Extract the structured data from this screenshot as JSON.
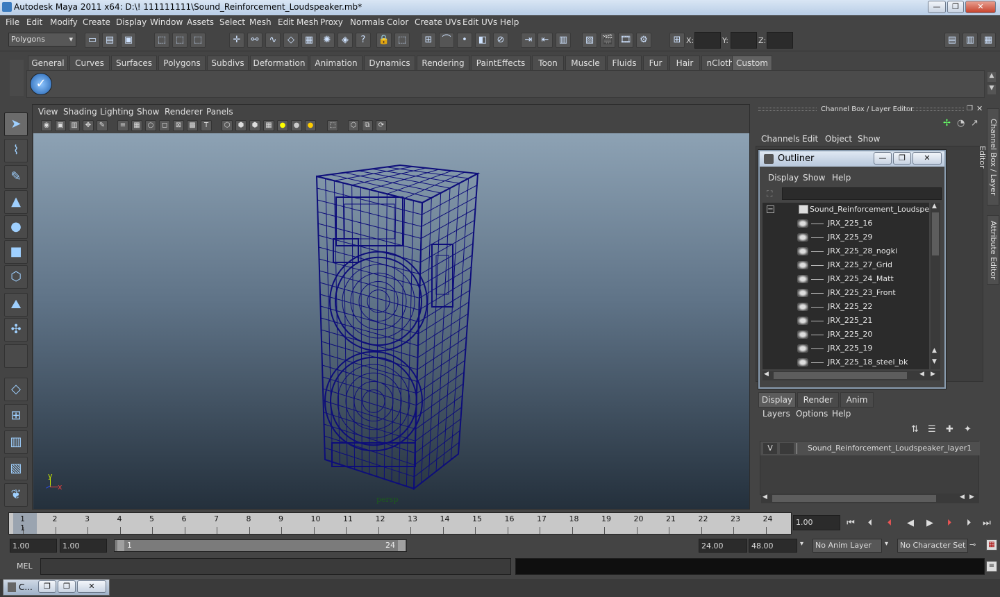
{
  "window": {
    "title": "Autodesk Maya 2011 x64: D:\\! 111111111\\Sound_Reinforcement_Loudspeaker.mb*",
    "minimize": "—",
    "restore": "❐",
    "close": "✕"
  },
  "menubar": [
    "File",
    "Edit",
    "Modify",
    "Create",
    "Display",
    "Window",
    "Assets",
    "Select",
    "Mesh",
    "Edit Mesh",
    "Proxy",
    "Normals",
    "Color",
    "Create UVs",
    "Edit UVs",
    "Help"
  ],
  "statusline": {
    "mode": "Polygons",
    "x_label": "X:",
    "y_label": "Y:",
    "z_label": "Z:"
  },
  "shelf": {
    "tabs": [
      "General",
      "Curves",
      "Surfaces",
      "Polygons",
      "Subdivs",
      "Deformation",
      "Animation",
      "Dynamics",
      "Rendering",
      "PaintEffects",
      "Toon",
      "Muscle",
      "Fluids",
      "Fur",
      "Hair",
      "nCloth",
      "Custom"
    ],
    "active": "Custom"
  },
  "viewport": {
    "menu": [
      "View",
      "Shading",
      "Lighting",
      "Show",
      "Renderer",
      "Panels"
    ],
    "camera": "persp",
    "axis_y": "y",
    "axis_x": "x"
  },
  "channelbox": {
    "title": "Channel Box / Layer Editor",
    "menu": [
      "Channels",
      "Edit",
      "Object",
      "Show"
    ]
  },
  "outliner": {
    "title": "Outliner",
    "menu": [
      "Display",
      "Show",
      "Help"
    ],
    "root": "Sound_Reinforcement_Loudspeaker",
    "items": [
      "JRX_225_16",
      "JRX_225_29",
      "JRX_225_28_nogki",
      "JRX_225_27_Grid",
      "JRX_225_24_Matt",
      "JRX_225_23_Front",
      "JRX_225_22",
      "JRX_225_21",
      "JRX_225_20",
      "JRX_225_19",
      "JRX_225_18_steel_bk"
    ]
  },
  "layers": {
    "tabs": [
      "Display",
      "Render",
      "Anim"
    ],
    "active": "Display",
    "menu": [
      "Layers",
      "Options",
      "Help"
    ],
    "visible_flag": "V",
    "layer_name": "Sound_Reinforcement_Loudspeaker_layer1"
  },
  "sidetabs": [
    "Channel Box / Layer Editor",
    "Attribute Editor"
  ],
  "timeline": {
    "ticks": [
      "1",
      "2",
      "3",
      "4",
      "5",
      "6",
      "7",
      "8",
      "9",
      "10",
      "11",
      "12",
      "13",
      "14",
      "15",
      "16",
      "17",
      "18",
      "19",
      "20",
      "21",
      "22",
      "23",
      "24"
    ],
    "current_frame": "1",
    "current_time_field": "1.00"
  },
  "range": {
    "start_time": "1.00",
    "playback_start": "1.00",
    "slider_start": "1",
    "slider_end": "24",
    "playback_end": "24.00",
    "end_time": "48.00",
    "anim_layer": "No Anim Layer",
    "character_set": "No Character Set"
  },
  "cmdline": {
    "label": "MEL"
  },
  "bottom": {
    "minimized_window": "C..."
  },
  "colors": {
    "wireframe": "#0d0d7a",
    "panel": "#444444",
    "viewport_top": "#8da2b4",
    "viewport_bottom": "#24303c"
  }
}
